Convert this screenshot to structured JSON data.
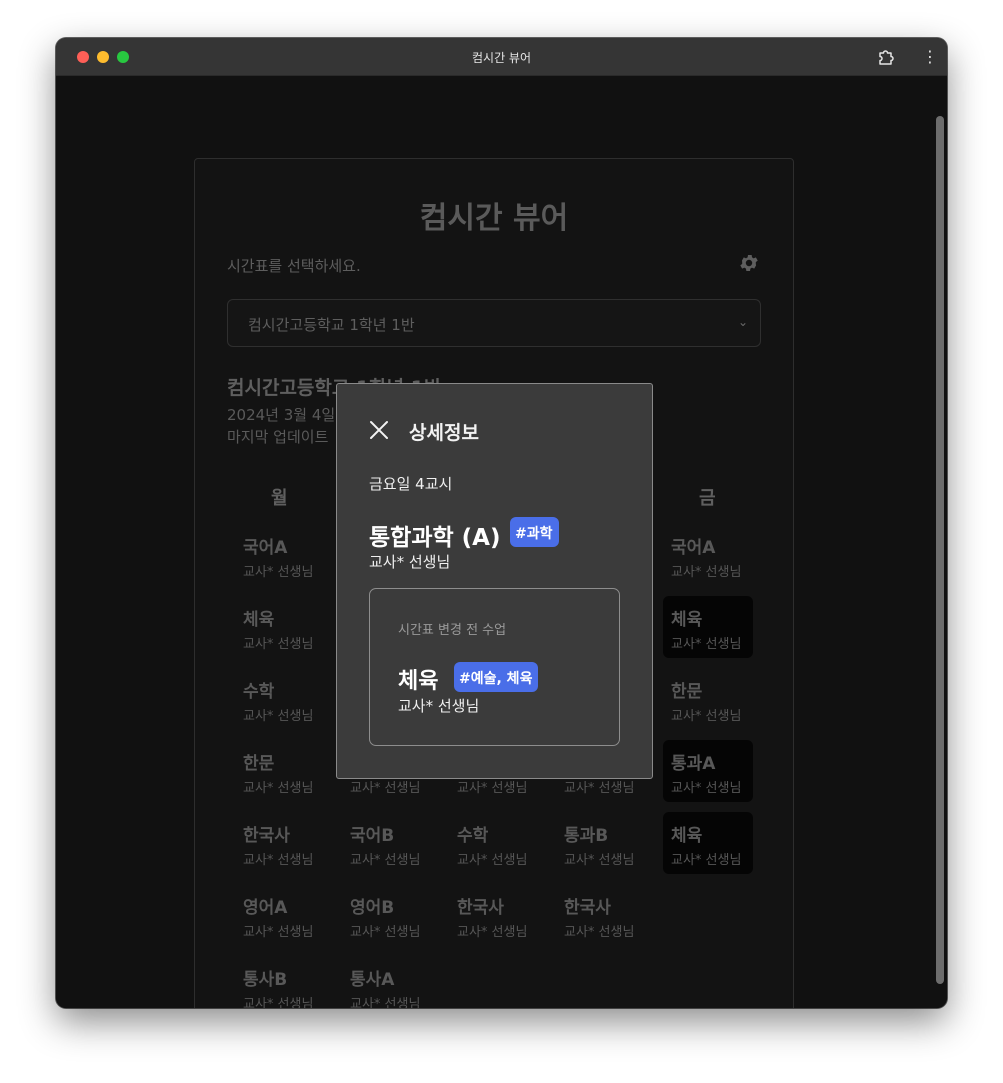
{
  "window": {
    "title": "컴시간 뷰어"
  },
  "app": {
    "title": "컴시간 뷰어",
    "hint": "시간표를 선택하세요.",
    "select_value": "컴시간고등학교 1학년 1반",
    "school_class": "컴시간고등학교 1학년 1반",
    "date_partial": "2024년 3월 4일",
    "updated_partial": "마지막 업데이트"
  },
  "days": [
    "월",
    "금"
  ],
  "timetable": {
    "mon": [
      {
        "subject": "국어A",
        "teacher": "교사* 선생님"
      },
      {
        "subject": "체육",
        "teacher": "교사* 선생님"
      },
      {
        "subject": "수학",
        "teacher": "교사* 선생님"
      },
      {
        "subject": "한문",
        "teacher": "교사* 선생님"
      },
      {
        "subject": "한국사",
        "teacher": "교사* 선생님"
      },
      {
        "subject": "영어A",
        "teacher": "교사* 선생님"
      },
      {
        "subject": "통사B",
        "teacher": "교사* 선생님"
      }
    ],
    "tue": [
      {
        "subject": "",
        "teacher": "교사* 선생님"
      },
      {
        "subject": "국어B",
        "teacher": "교사* 선생님"
      },
      {
        "subject": "영어B",
        "teacher": "교사* 선생님"
      },
      {
        "subject": "통사A",
        "teacher": "교사* 선생님"
      }
    ],
    "wed": [
      {
        "subject": "",
        "teacher": "교사* 선생님"
      },
      {
        "subject": "수학",
        "teacher": "교사* 선생님"
      },
      {
        "subject": "한국사",
        "teacher": "교사* 선생님"
      }
    ],
    "thu": [
      {
        "subject": "",
        "teacher": "교사* 선생님"
      },
      {
        "subject": "통과B",
        "teacher": "교사* 선생님"
      },
      {
        "subject": "한국사",
        "teacher": "교사* 선생님"
      }
    ],
    "fri": [
      {
        "subject": "국어A",
        "teacher": "교사* 선생님"
      },
      {
        "subject": "체육",
        "teacher": "교사* 선생님"
      },
      {
        "subject": "한문",
        "teacher": "교사* 선생님"
      },
      {
        "subject": "통과A",
        "teacher": "교사* 선생님"
      },
      {
        "subject": "체육",
        "teacher": "교사* 선생님"
      }
    ]
  },
  "modal": {
    "title": "상세정보",
    "period": "금요일 4교시",
    "subject": "통합과학 (A)",
    "tag": "#과학",
    "teacher": "교사* 선생님",
    "previous": {
      "label": "시간표 변경 전 수업",
      "subject": "체육",
      "tag": "#예술, 체육",
      "teacher": "교사* 선생님"
    }
  },
  "colors": {
    "tag": "#4a6ee8",
    "background": "#111111",
    "modal": "#3b3b3b"
  },
  "icons": [
    "close-icon",
    "gear-icon",
    "chevron-down-icon",
    "puzzle-icon",
    "more-vertical-icon"
  ]
}
